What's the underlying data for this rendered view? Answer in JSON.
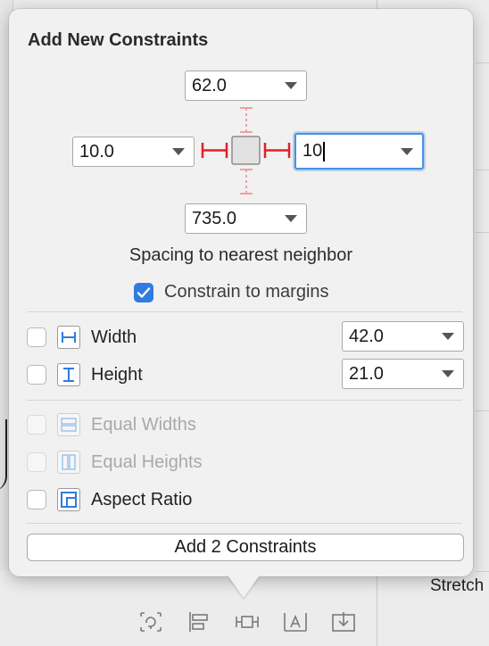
{
  "title": "Add New Constraints",
  "pins": {
    "top": "62.0",
    "left": "10.0",
    "right": "10",
    "bottom": "735.0"
  },
  "spacing_label": "Spacing to nearest neighbor",
  "constrain_margins": {
    "label": "Constrain to margins",
    "checked": true
  },
  "size_rows": [
    {
      "label": "Width",
      "value": "42.0",
      "icon": "width-constraint-icon",
      "checked": false
    },
    {
      "label": "Height",
      "value": "21.0",
      "icon": "height-constraint-icon",
      "checked": false
    }
  ],
  "equal_rows": [
    {
      "label": "Equal Widths",
      "icon": "equal-widths-icon",
      "enabled": false
    },
    {
      "label": "Equal Heights",
      "icon": "equal-heights-icon",
      "enabled": false
    },
    {
      "label": "Aspect Ratio",
      "icon": "aspect-ratio-icon",
      "enabled": true
    }
  ],
  "add_button": "Add 2 Constraints",
  "background": {
    "stretch_label": "Stretch"
  },
  "colors": {
    "accent": "#2f7ce0",
    "pin_active": "#e0202a",
    "pin_inactive": "#f0a0a4"
  }
}
